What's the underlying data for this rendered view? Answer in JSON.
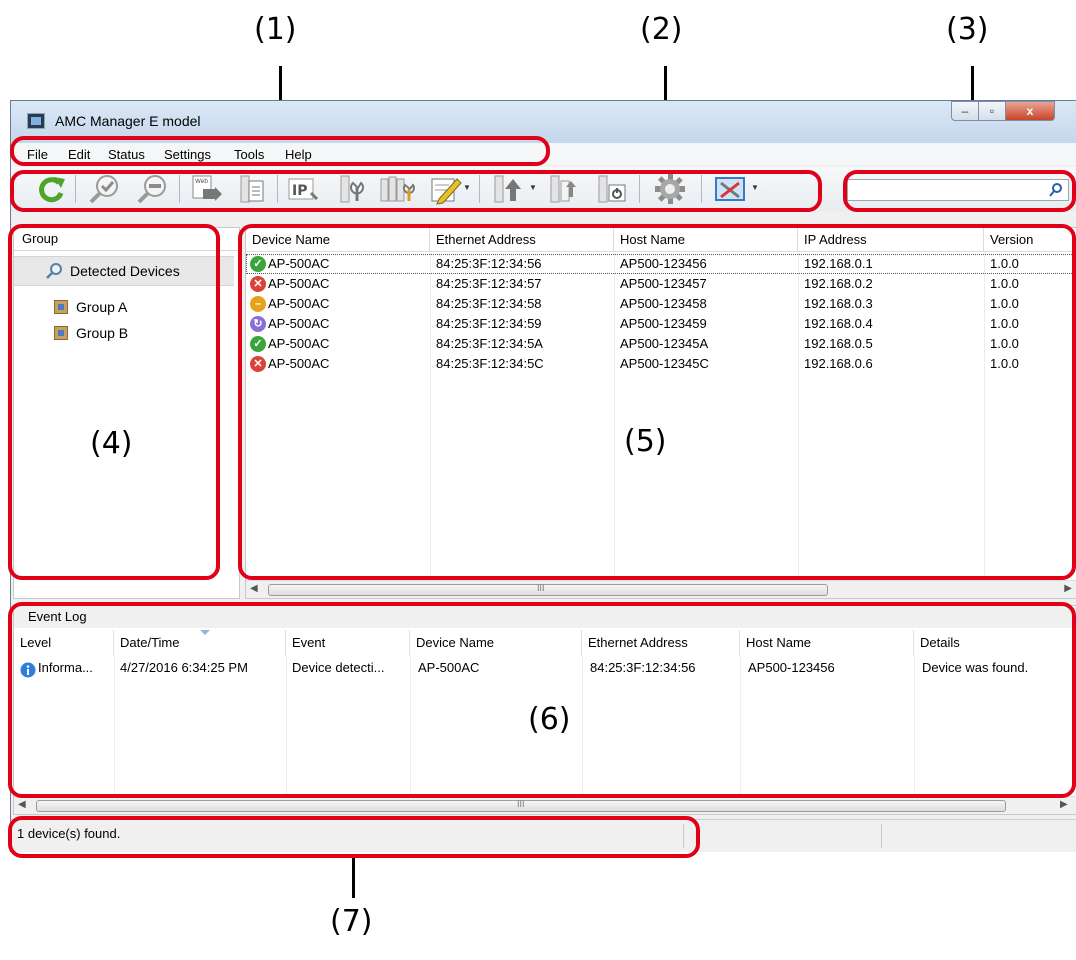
{
  "callouts": [
    "(1)",
    "(2)",
    "(3)",
    "(4)",
    "(5)",
    "(6)",
    "(7)"
  ],
  "window": {
    "title": "AMC Manager E model",
    "controls": {
      "minimize": "–",
      "maximize": "▫",
      "close": "x"
    }
  },
  "menu": [
    {
      "label": "File"
    },
    {
      "label": "Edit"
    },
    {
      "label": "Status"
    },
    {
      "label": "Settings"
    },
    {
      "label": "Tools"
    },
    {
      "label": "Help"
    }
  ],
  "toolbar_icons": [
    "refresh-icon",
    "zoom-check-icon",
    "zoom-minus-icon",
    "web-page-icon",
    "document-icon",
    "ip-settings-icon",
    "device-tool-icon",
    "multi-device-tool-icon",
    "edit-icon",
    "upload-firmware-icon",
    "firmware-update-icon",
    "reboot-icon",
    "gear-icon",
    "settings-tool-icon"
  ],
  "search": {
    "placeholder": ""
  },
  "group_panel": {
    "header": "Group",
    "detected": "Detected Devices",
    "groups": [
      "Group A",
      "Group B"
    ]
  },
  "device_list": {
    "columns": [
      "Device Name",
      "Ethernet Address",
      "Host Name",
      "IP Address",
      "Version"
    ],
    "rows": [
      {
        "status": "ok",
        "name": "AP-500AC",
        "mac": "84:25:3F:12:34:56",
        "host": "AP500-123456",
        "ip": "192.168.0.1",
        "version": "1.0.0"
      },
      {
        "status": "error",
        "name": "AP-500AC",
        "mac": "84:25:3F:12:34:57",
        "host": "AP500-123457",
        "ip": "192.168.0.2",
        "version": "1.0.0"
      },
      {
        "status": "warning",
        "name": "AP-500AC",
        "mac": "84:25:3F:12:34:58",
        "host": "AP500-123458",
        "ip": "192.168.0.3",
        "version": "1.0.0"
      },
      {
        "status": "updating",
        "name": "AP-500AC",
        "mac": "84:25:3F:12:34:59",
        "host": "AP500-123459",
        "ip": "192.168.0.4",
        "version": "1.0.0"
      },
      {
        "status": "ok",
        "name": "AP-500AC",
        "mac": "84:25:3F:12:34:5A",
        "host": "AP500-12345A",
        "ip": "192.168.0.5",
        "version": "1.0.0"
      },
      {
        "status": "error",
        "name": "AP-500AC",
        "mac": "84:25:3F:12:34:5C",
        "host": "AP500-12345C",
        "ip": "192.168.0.6",
        "version": "1.0.0"
      }
    ],
    "scroll_thumb": "III"
  },
  "event_log": {
    "title": "Event Log",
    "columns": [
      "Level",
      "Date/Time",
      "Event",
      "Device Name",
      "Ethernet Address",
      "Host Name",
      "Details"
    ],
    "rows": [
      {
        "level": "Informa...",
        "datetime": "4/27/2016 6:34:25 PM",
        "event": "Device detecti...",
        "device": "AP-500AC",
        "mac": "84:25:3F:12:34:56",
        "host": "AP500-123456",
        "details": "Device was found."
      }
    ],
    "scroll_thumb": "III"
  },
  "status_bar": {
    "text": "1 device(s) found."
  },
  "colors": {
    "annotation": "#e00018",
    "ok": "#3aa53a",
    "error": "#d9443a",
    "warning": "#e5a21a",
    "updating": "#8a6fd6",
    "info": "#2f7fd8"
  }
}
